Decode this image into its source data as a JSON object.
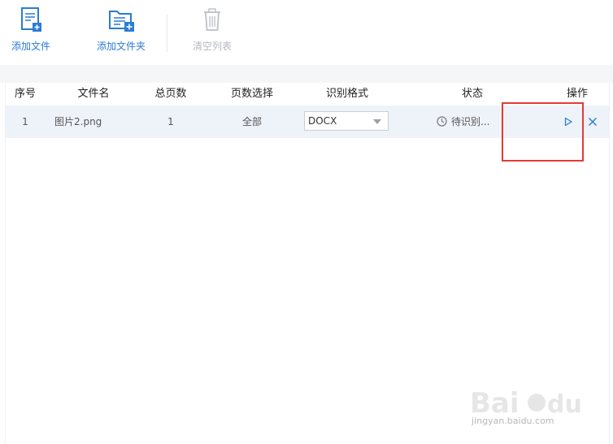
{
  "toolbar": {
    "add_file": "添加文件",
    "add_folder": "添加文件夹",
    "clear_list": "清空列表"
  },
  "table": {
    "headers": [
      "序号",
      "文件名",
      "总页数",
      "页数选择",
      "识别格式",
      "状态",
      "操作"
    ],
    "rows": [
      {
        "index": "1",
        "file_name": "图片2.png",
        "total_pages": "1",
        "page_selection": "全部",
        "format": "DOCX",
        "status": "待识别..."
      }
    ]
  },
  "watermark": {
    "text": "jingyan.baidu.com"
  },
  "colors": {
    "accent": "#2b7cd3",
    "disabled": "#b5b9c0",
    "row_bg": "#eef2f9",
    "highlight": "#e53935"
  },
  "icons": {
    "add_file": "add-file-icon",
    "add_folder": "add-folder-icon",
    "clear": "trash-icon",
    "status": "clock-icon",
    "start": "play-icon",
    "delete": "close-icon"
  }
}
